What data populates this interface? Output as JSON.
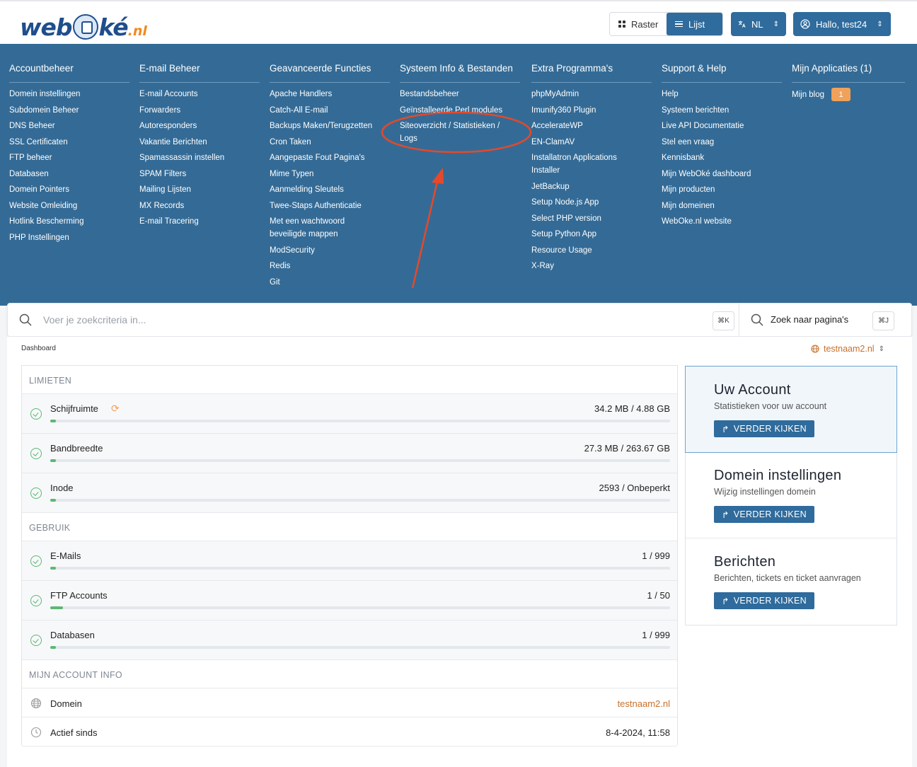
{
  "header": {
    "logo": {
      "main_a": "web",
      "main_b": "ké",
      "tld": ".nl"
    },
    "view": {
      "raster": "Raster",
      "lijst": "Lijst"
    },
    "language": "NL",
    "user": "Hallo, test24"
  },
  "nav": [
    {
      "title": "Accountbeheer",
      "items": [
        "Domein instellingen",
        "Subdomein Beheer",
        "DNS Beheer",
        "SSL Certificaten",
        "FTP beheer",
        "Databasen",
        "Domein Pointers",
        "Website Omleiding",
        "Hotlink Bescherming",
        "PHP Instellingen"
      ]
    },
    {
      "title": "E-mail Beheer",
      "items": [
        "E-mail Accounts",
        "Forwarders",
        "Autoresponders",
        "Vakantie Berichten",
        "Spamassassin instellen",
        "SPAM Filters",
        "Mailing Lijsten",
        "MX Records",
        "E-mail Tracering"
      ]
    },
    {
      "title": "Geavanceerde Functies",
      "items": [
        "Apache Handlers",
        "Catch-All E-mail",
        "Backups Maken/Terugzetten",
        "Cron Taken",
        "Aangepaste Fout Pagina's",
        "Mime Typen",
        "Aanmelding Sleutels",
        "Twee-Staps Authenticatie",
        "Met een wachtwoord beveiligde mappen",
        "ModSecurity",
        "Redis",
        "Git"
      ]
    },
    {
      "title": "Systeem Info & Bestanden",
      "items": [
        "Bestandsbeheer",
        "Geïnstalleerde Perl modules",
        "Siteoverzicht / Statistieken / Logs"
      ]
    },
    {
      "title": "Extra Programma's",
      "items": [
        "phpMyAdmin",
        "Imunify360 Plugin",
        "AccelerateWP",
        "EN-ClamAV",
        "Installatron Applications Installer",
        "JetBackup",
        "Setup Node.js App",
        "Select PHP version",
        "Setup Python App",
        "Resource Usage",
        "X-Ray"
      ]
    },
    {
      "title": "Support & Help",
      "items": [
        "Help",
        "Systeem berichten",
        "Live API Documentatie",
        "Stel een vraag",
        "Kennisbank",
        "Mijn WebOké dashboard",
        "Mijn producten",
        "Mijn domeinen",
        "WebOke.nl website"
      ]
    },
    {
      "title": "Mijn Applicaties (1)",
      "items": [
        "Mijn blog"
      ],
      "badge": "1"
    }
  ],
  "search": {
    "placeholder": "Voer je zoekcriteria in...",
    "shortcut1": "⌘K",
    "pages_label": "Zoek naar pagina's",
    "shortcut2": "⌘J"
  },
  "breadcrumb": "Dashboard",
  "domain_selector": "testnaam2.nl",
  "limits": {
    "section": "LIMIETEN",
    "rows": [
      {
        "label": "Schijfruimte",
        "value": "34.2 MB / 4.88 GB",
        "progress": 0.007
      },
      {
        "label": "Bandbreedte",
        "value": "27.3 MB / 263.67 GB",
        "progress": 0.0001
      },
      {
        "label": "Inode",
        "value": "2593 / Onbeperkt",
        "progress": 0.0
      }
    ]
  },
  "usage": {
    "section": "GEBRUIK",
    "rows": [
      {
        "label": "E-Mails",
        "value": "1 / 999",
        "progress": 0.001
      },
      {
        "label": "FTP Accounts",
        "value": "1 / 50",
        "progress": 0.02
      },
      {
        "label": "Databasen",
        "value": "1 / 999",
        "progress": 0.001
      }
    ]
  },
  "account_info": {
    "section": "MIJN ACCOUNT INFO",
    "domain_label": "Domein",
    "domain_value": "testnaam2.nl",
    "since_label": "Actief sinds",
    "since_value": "8-4-2024, 11:58"
  },
  "cards": [
    {
      "title": "Uw Account",
      "subtitle": "Statistieken voor uw account",
      "button": "VERDER KIJKEN"
    },
    {
      "title": "Domein instellingen",
      "subtitle": "Wijzig instellingen domein",
      "button": "VERDER KIJKEN"
    },
    {
      "title": "Berichten",
      "subtitle": "Berichten, tickets en ticket aanvragen",
      "button": "VERDER KIJKEN"
    }
  ],
  "colors": {
    "nav_bg": "#346b96",
    "primary": "#2f6b9c",
    "accent": "#c9702a",
    "success": "#5cb873",
    "annotation": "#e5492a"
  }
}
